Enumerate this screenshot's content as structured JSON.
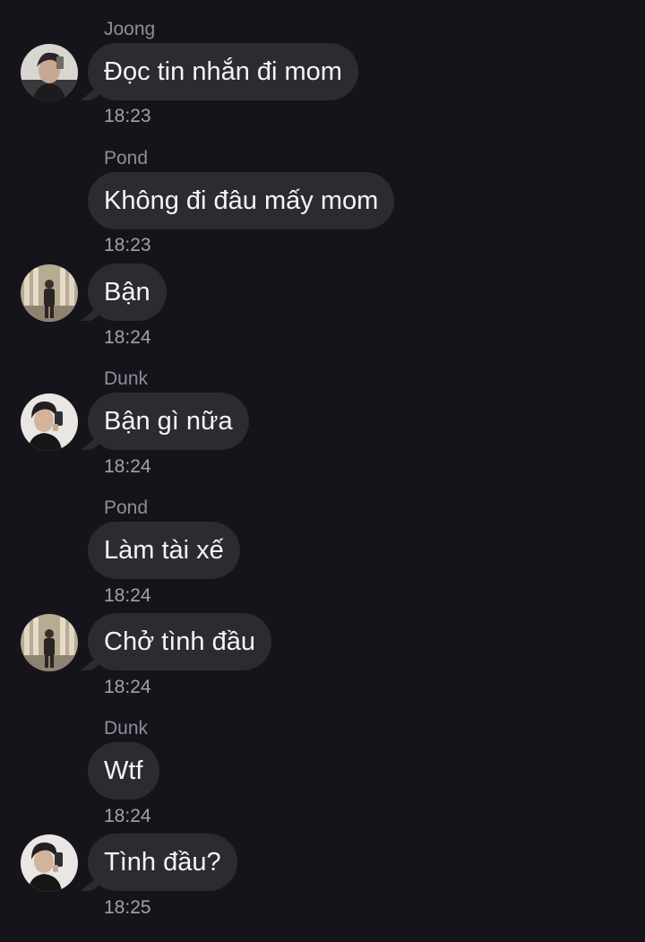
{
  "colors": {
    "background": "#16141b",
    "bubble": "#2c2b31",
    "message_text": "#f5f5f7",
    "meta_text": "#8f8d98"
  },
  "messages": [
    {
      "sender": "Joong",
      "text": "Đọc tin nhắn đi mom",
      "time": "18:23",
      "avatar": "joong-avatar"
    },
    {
      "sender": "Pond",
      "text": "Không đi đâu mấy mom",
      "time": "18:23",
      "avatar": ""
    },
    {
      "sender": "",
      "text": "Bận",
      "time": "18:24",
      "avatar": "pond-avatar"
    },
    {
      "sender": "Dunk",
      "text": "Bận gì nữa",
      "time": "18:24",
      "avatar": "dunk-avatar"
    },
    {
      "sender": "Pond",
      "text": "Làm tài xế",
      "time": "18:24",
      "avatar": ""
    },
    {
      "sender": "",
      "text": "Chở tình đầu",
      "time": "18:24",
      "avatar": "pond-avatar"
    },
    {
      "sender": "Dunk",
      "text": "Wtf",
      "time": "18:24",
      "avatar": ""
    },
    {
      "sender": "",
      "text": "Tình đầu?",
      "time": "18:25",
      "avatar": "dunk-avatar"
    }
  ]
}
